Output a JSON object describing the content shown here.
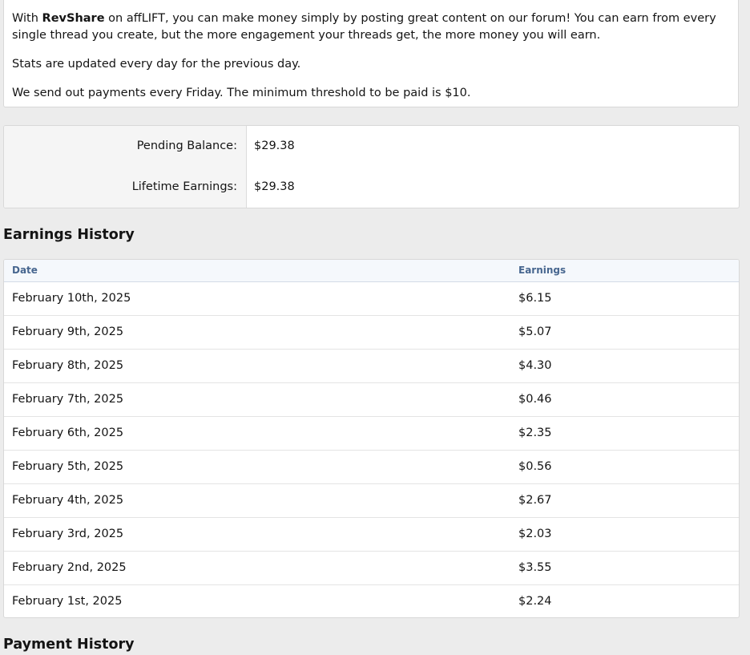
{
  "intro": {
    "line1_prefix": "With ",
    "line1_bold": "RevShare",
    "line1_suffix": " on affLIFT, you can make money simply by posting great content on our forum! You can earn from every single thread you create, but the more engagement your threads get, the more money you will earn.",
    "line2": "Stats are updated every day for the previous day.",
    "line3": "We send out payments every Friday. The minimum threshold to be paid is $10."
  },
  "balance": {
    "pending_label": "Pending Balance:",
    "pending_value": "$29.38",
    "lifetime_label": "Lifetime Earnings:",
    "lifetime_value": "$29.38"
  },
  "earnings_history": {
    "heading": "Earnings History",
    "columns": {
      "date": "Date",
      "earnings": "Earnings"
    },
    "rows": [
      {
        "date": "February 10th, 2025",
        "earnings": "$6.15"
      },
      {
        "date": "February 9th, 2025",
        "earnings": "$5.07"
      },
      {
        "date": "February 8th, 2025",
        "earnings": "$4.30"
      },
      {
        "date": "February 7th, 2025",
        "earnings": "$0.46"
      },
      {
        "date": "February 6th, 2025",
        "earnings": "$2.35"
      },
      {
        "date": "February 5th, 2025",
        "earnings": "$0.56"
      },
      {
        "date": "February 4th, 2025",
        "earnings": "$2.67"
      },
      {
        "date": "February 3rd, 2025",
        "earnings": "$2.03"
      },
      {
        "date": "February 2nd, 2025",
        "earnings": "$3.55"
      },
      {
        "date": "February 1st, 2025",
        "earnings": "$2.24"
      }
    ]
  },
  "payment_history": {
    "heading": "Payment History"
  }
}
